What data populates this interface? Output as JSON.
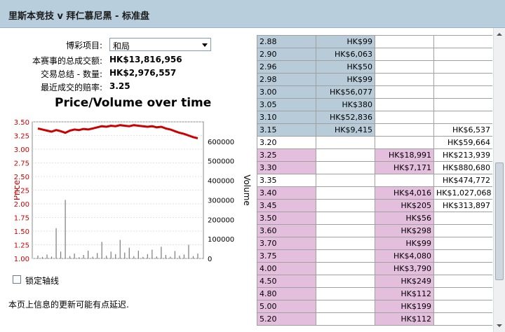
{
  "window": {
    "title": "里斯本竞技 v 拜仁慕尼黑 - 标准盘"
  },
  "info": {
    "market_label": "博彩项目:",
    "market_selected": "和局",
    "total_matched_label": "本赛事的总成交额:",
    "total_matched_value": "HK$13,816,956",
    "traded_label": "交易总结 - 数量:",
    "traded_value": "HK$2,976,557",
    "last_price_label": "最近成交的赔率:",
    "last_price_value": "3.25"
  },
  "chart_data": {
    "type": "line",
    "title": "Price/Volume over time",
    "ylabel": "Price",
    "y2label": "Volume",
    "ylim": [
      1.0,
      3.5
    ],
    "y2lim": [
      0,
      700000
    ],
    "yticks": [
      "3.50",
      "3.25",
      "3.00",
      "2.75",
      "2.50",
      "2.25",
      "2.00",
      "1.75",
      "1.50",
      "1.25",
      "1.00"
    ],
    "y2ticks": [
      "600000",
      "500000",
      "400000",
      "300000",
      "200000",
      "100000",
      "0"
    ],
    "series": [
      {
        "kind": "price",
        "color": "#cc0000",
        "values": [
          3.38,
          3.36,
          3.34,
          3.32,
          3.35,
          3.33,
          3.3,
          3.34,
          3.36,
          3.35,
          3.37,
          3.36,
          3.38,
          3.4,
          3.42,
          3.41,
          3.43,
          3.42,
          3.44,
          3.43,
          3.42,
          3.44,
          3.43,
          3.42,
          3.41,
          3.42,
          3.4,
          3.41,
          3.38,
          3.36,
          3.33,
          3.3,
          3.28,
          3.25,
          3.22,
          3.2
        ]
      },
      {
        "kind": "volume",
        "color": "#7a7a7a",
        "values": [
          15000,
          8000,
          20000,
          10000,
          155000,
          35000,
          300000,
          12000,
          25000,
          6000,
          18000,
          40000,
          9000,
          28000,
          85000,
          14000,
          35000,
          22000,
          95000,
          30000,
          55000,
          12000,
          40000,
          8000,
          22000,
          45000,
          10000,
          60000,
          18000,
          9000,
          38000,
          14000,
          20000,
          70000,
          12000,
          25000
        ]
      }
    ]
  },
  "lock_axis_label": "锁定轴线",
  "note": "本页上信息的更新可能有点延迟.",
  "book": {
    "rows": [
      {
        "price": "2.88",
        "back": "HK$99",
        "lay": "",
        "traded": "",
        "tone": "blue"
      },
      {
        "price": "2.90",
        "back": "HK$6,063",
        "lay": "",
        "traded": "",
        "tone": "blue"
      },
      {
        "price": "2.96",
        "back": "HK$50",
        "lay": "",
        "traded": "",
        "tone": "blue"
      },
      {
        "price": "2.98",
        "back": "HK$99",
        "lay": "",
        "traded": "",
        "tone": "blue"
      },
      {
        "price": "3.00",
        "back": "HK$56,077",
        "lay": "",
        "traded": "",
        "tone": "blue"
      },
      {
        "price": "3.05",
        "back": "HK$380",
        "lay": "",
        "traded": "",
        "tone": "blue"
      },
      {
        "price": "3.10",
        "back": "HK$52,836",
        "lay": "",
        "traded": "",
        "tone": "blue"
      },
      {
        "price": "3.15",
        "back": "HK$9,415",
        "lay": "",
        "traded": "HK$6,537",
        "tone": "blue"
      },
      {
        "price": "3.20",
        "back": "",
        "lay": "",
        "traded": "HK$59,664",
        "tone": "none"
      },
      {
        "price": "3.25",
        "back": "",
        "lay": "HK$18,991",
        "traded": "HK$213,939",
        "tone": "pink"
      },
      {
        "price": "3.30",
        "back": "",
        "lay": "HK$7,171",
        "traded": "HK$880,680",
        "tone": "pink"
      },
      {
        "price": "3.35",
        "back": "",
        "lay": "",
        "traded": "HK$474,772",
        "tone": "none"
      },
      {
        "price": "3.40",
        "back": "",
        "lay": "HK$4,016",
        "traded": "HK$1,027,068",
        "tone": "pink"
      },
      {
        "price": "3.45",
        "back": "",
        "lay": "HK$205",
        "traded": "HK$313,897",
        "tone": "pink"
      },
      {
        "price": "3.50",
        "back": "",
        "lay": "HK$56",
        "traded": "",
        "tone": "pink"
      },
      {
        "price": "3.60",
        "back": "",
        "lay": "HK$298",
        "traded": "",
        "tone": "pink"
      },
      {
        "price": "3.70",
        "back": "",
        "lay": "HK$99",
        "traded": "",
        "tone": "pink"
      },
      {
        "price": "3.75",
        "back": "",
        "lay": "HK$4,080",
        "traded": "",
        "tone": "pink"
      },
      {
        "price": "4.00",
        "back": "",
        "lay": "HK$3,790",
        "traded": "",
        "tone": "pink"
      },
      {
        "price": "4.50",
        "back": "",
        "lay": "HK$249",
        "traded": "",
        "tone": "pink"
      },
      {
        "price": "4.80",
        "back": "",
        "lay": "HK$112",
        "traded": "",
        "tone": "pink"
      },
      {
        "price": "5.00",
        "back": "",
        "lay": "HK$199",
        "traded": "",
        "tone": "pink"
      },
      {
        "price": "5.20",
        "back": "",
        "lay": "HK$112",
        "traded": "",
        "tone": "pink"
      }
    ]
  },
  "colors": {
    "titlebar": "#b9cedd",
    "back_cell": "#b7cbd8",
    "lay_cell": "#e4bfdd",
    "price_line": "#cc0000"
  },
  "icons": {
    "dropdown": "chevron-down-icon",
    "checkbox": "checkbox-icon",
    "scroll_up": "arrow-up-icon",
    "scroll_down": "arrow-down-icon"
  }
}
